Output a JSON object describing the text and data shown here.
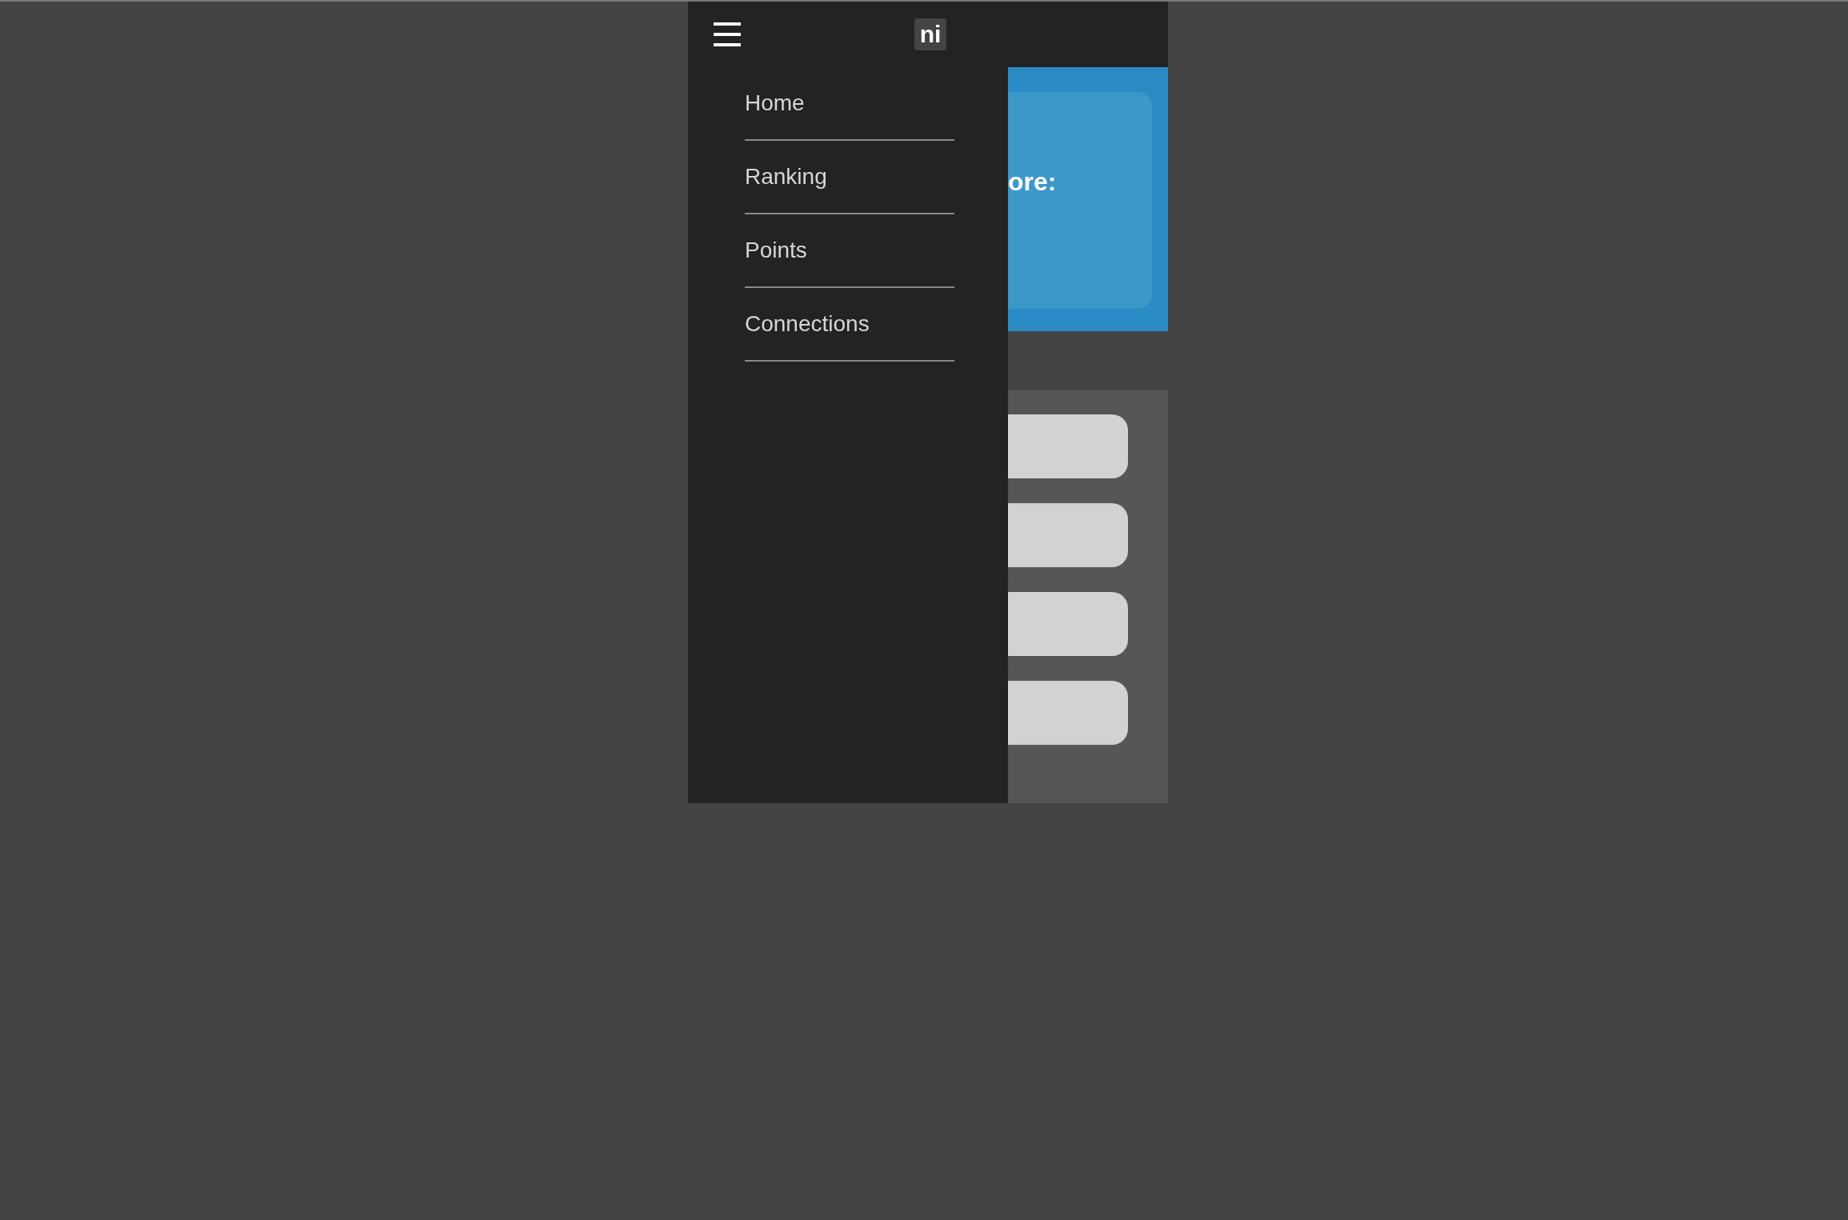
{
  "header": {
    "logo": "ni"
  },
  "menu": {
    "items": [
      {
        "label": "Home"
      },
      {
        "label": "Ranking"
      },
      {
        "label": "Points"
      },
      {
        "label": "Connections"
      }
    ]
  },
  "banner": {
    "text": "ore:"
  },
  "content": {
    "buttons": [
      {
        "kind": "blank"
      },
      {
        "kind": "blank"
      },
      {
        "kind": "blank"
      },
      {
        "kind": "blank"
      }
    ]
  }
}
